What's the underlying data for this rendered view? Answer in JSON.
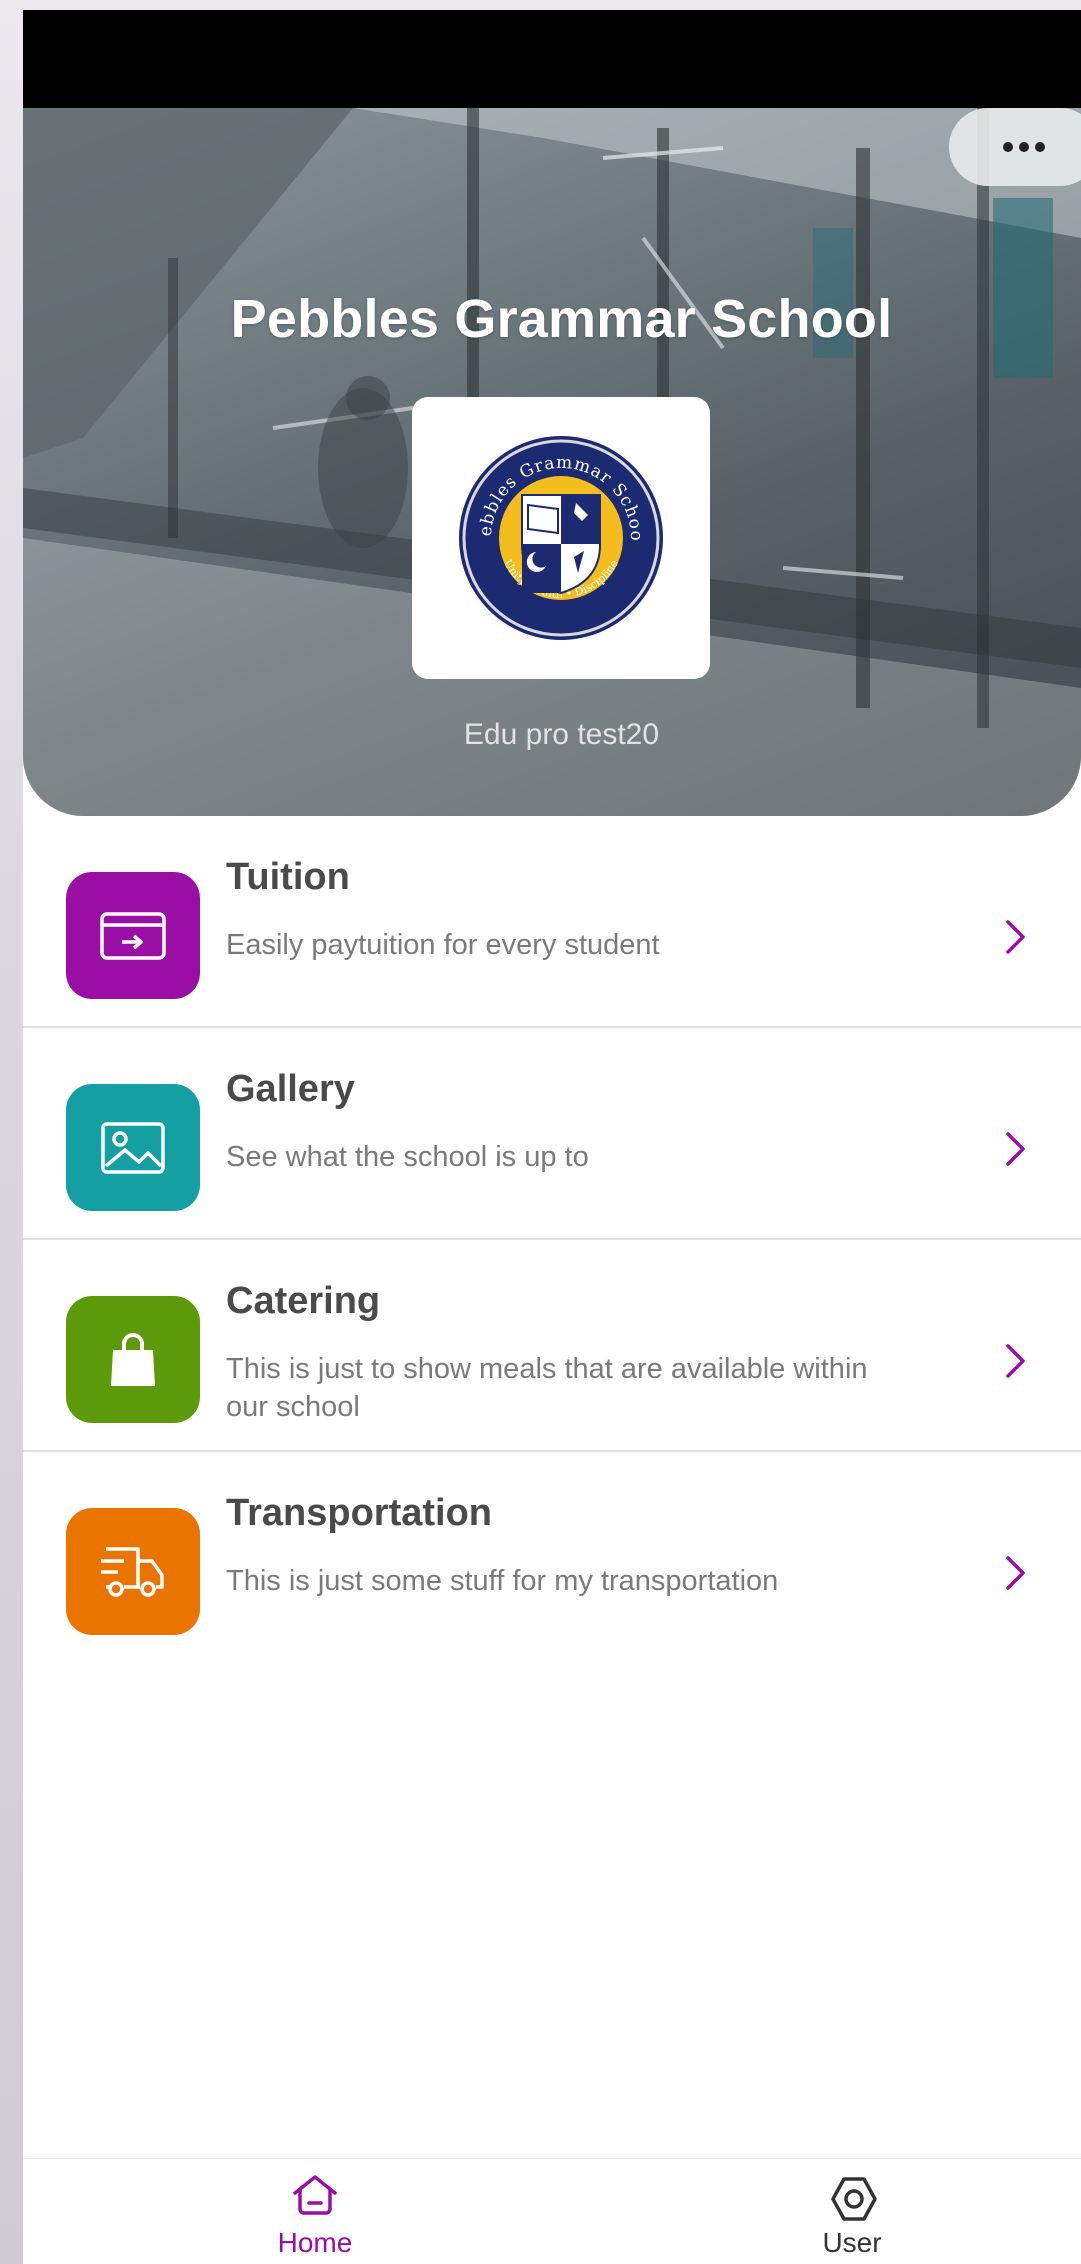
{
  "hero": {
    "title": "Pebbles Grammar School",
    "subtitle": "Edu pro test20",
    "logo": {
      "top_text": "Pebbles Grammar School",
      "bottom_text": "Unity • Faith • Discipline"
    }
  },
  "menu": [
    {
      "title": "Tuition",
      "description": "Easily paytuition for every student",
      "icon": "payment-card-icon",
      "color": "#9a0ea6"
    },
    {
      "title": "Gallery",
      "description": "See what the school is up to",
      "icon": "image-icon",
      "color": "#14a0a3"
    },
    {
      "title": "Catering",
      "description": "This is just to show meals that are available within our school",
      "icon": "shopping-bag-icon",
      "color": "#5c9a0a"
    },
    {
      "title": "Transportation",
      "description": "This is just some stuff for my transportation",
      "icon": "delivery-truck-icon",
      "color": "#ea7400"
    }
  ],
  "bottom_nav": [
    {
      "label": "Home",
      "icon": "home-icon",
      "active": true
    },
    {
      "label": "User",
      "icon": "gear-icon",
      "active": false
    }
  ],
  "colors": {
    "accent": "#9a0ea6",
    "title_text": "#4a4a4a",
    "description_text": "#7a7a7a",
    "inactive_nav": "#333333"
  }
}
